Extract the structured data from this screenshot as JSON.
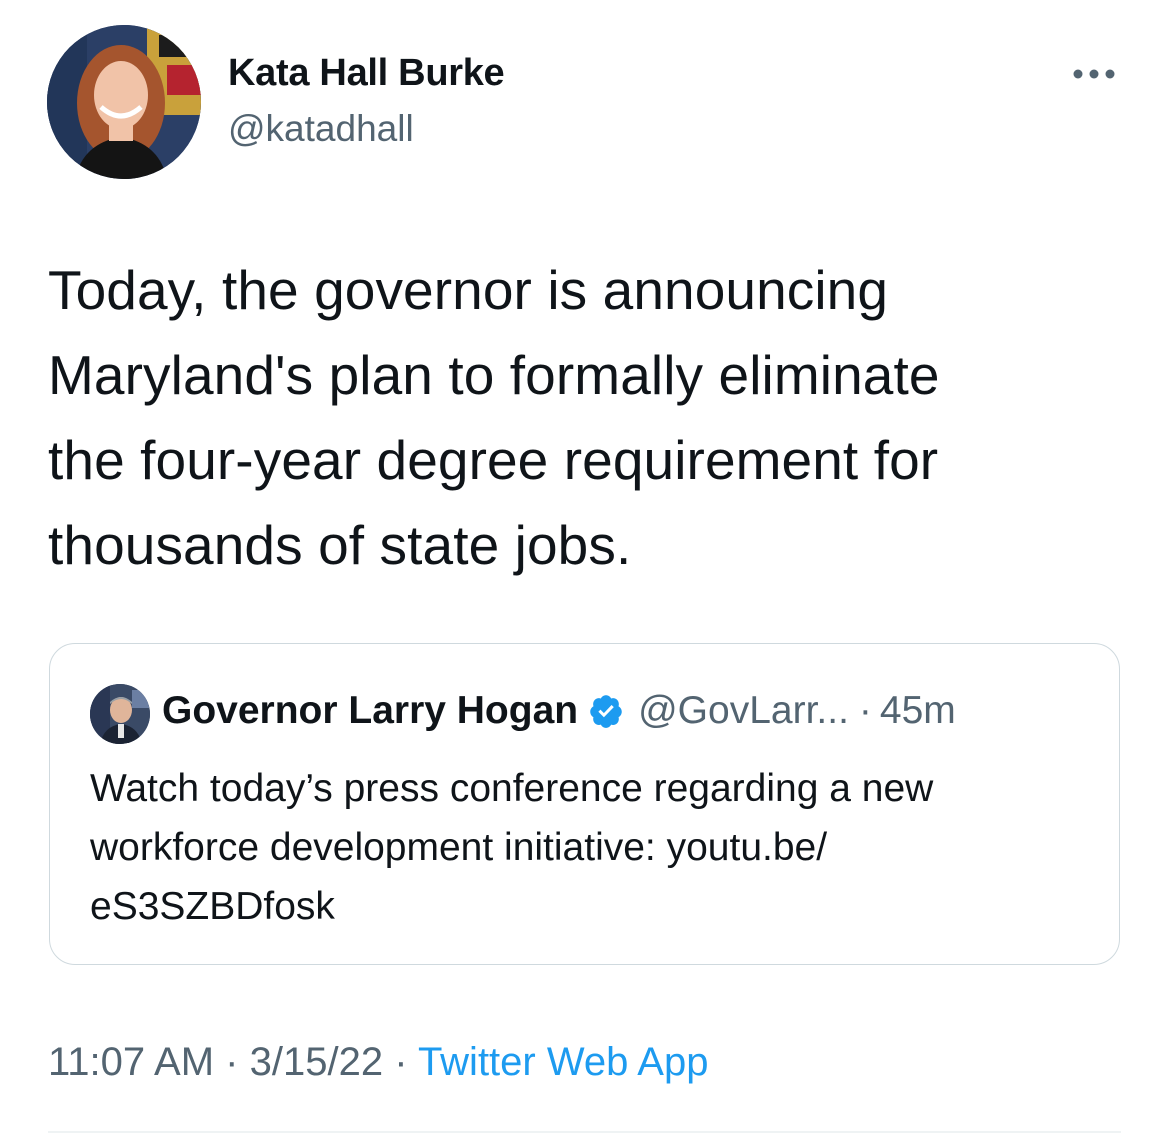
{
  "author": {
    "display_name": "Kata Hall Burke",
    "handle": "@katadhall"
  },
  "tweet": {
    "lines": [
      "Today, the governor is announcing",
      "Maryland's plan to formally eliminate",
      "the four-year degree requirement for",
      "thousands of state jobs."
    ]
  },
  "quoted_tweet": {
    "display_name": "Governor Larry Hogan",
    "verified": true,
    "handle": "@GovLarr...",
    "separator": "·",
    "time": "45m",
    "lines": [
      "Watch today’s press conference regarding a new",
      "workforce development initiative: youtu.be/",
      "eS3SZBDfosk"
    ]
  },
  "meta": {
    "time": "11:07 AM",
    "separator": "·",
    "date": "3/15/22",
    "source": "Twitter Web App"
  },
  "icons": {
    "more": "more-horizontal-icon",
    "verified": "verified-badge-icon"
  },
  "colors": {
    "text": "#0f1419",
    "secondary": "#536471",
    "link": "#1d9bf0",
    "border": "#cfd9de",
    "verified": "#1d9bf0"
  }
}
